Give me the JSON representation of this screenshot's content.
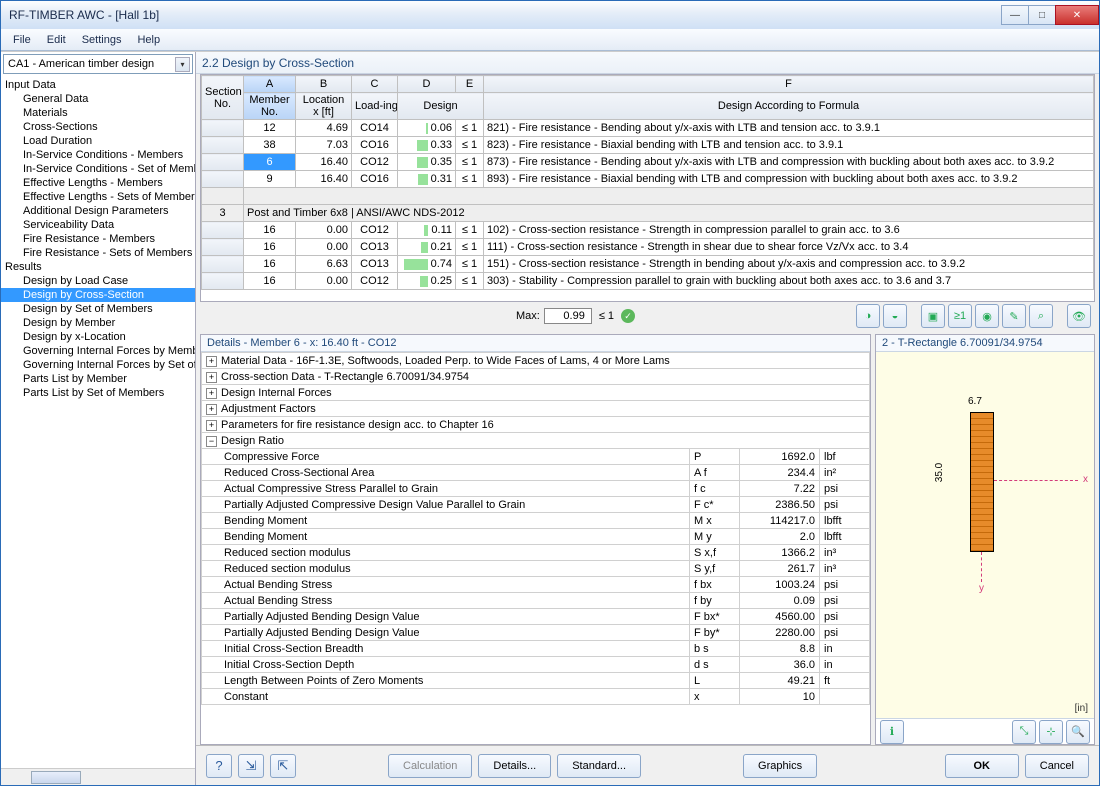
{
  "window": {
    "title": "RF-TIMBER AWC - [Hall 1b]"
  },
  "menu": [
    "File",
    "Edit",
    "Settings",
    "Help"
  ],
  "combo": "CA1 - American timber design",
  "tree": {
    "input_header": "Input Data",
    "input_items": [
      "General Data",
      "Materials",
      "Cross-Sections",
      "Load Duration",
      "In-Service Conditions - Members",
      "In-Service Conditions - Set of Members",
      "Effective Lengths - Members",
      "Effective Lengths - Sets of Members",
      "Additional Design Parameters",
      "Serviceability Data",
      "Fire Resistance - Members",
      "Fire Resistance - Sets of Members"
    ],
    "results_header": "Results",
    "results_items": [
      "Design by Load Case",
      "Design by Cross-Section",
      "Design by Set of Members",
      "Design by Member",
      "Design by x-Location",
      "Governing Internal Forces by Member",
      "Governing Internal Forces by Set of Members",
      "Parts List by Member",
      "Parts List by Set of Members"
    ],
    "selected": "Design by Cross-Section"
  },
  "section_title": "2.2  Design by Cross-Section",
  "grid": {
    "colLetters": [
      "A",
      "B",
      "C",
      "D",
      "E",
      "F"
    ],
    "h_section": "Section No.",
    "h_member": "Member No.",
    "h_location": "Location x [ft]",
    "h_loading": "Load-ing",
    "h_design": "Design",
    "h_formula": "Design According to Formula",
    "rows": [
      {
        "member": "12",
        "x": "4.69",
        "load": "CO14",
        "bar": 6,
        "design": "0.06",
        "le": "≤ 1",
        "desc": "821) - Fire resistance - Bending about y/x-axis with LTB and tension acc. to 3.9.1"
      },
      {
        "member": "38",
        "x": "7.03",
        "load": "CO16",
        "bar": 33,
        "design": "0.33",
        "le": "≤ 1",
        "desc": "823) - Fire resistance - Biaxial bending with LTB and tension acc. to 3.9.1"
      },
      {
        "member": "6",
        "x": "16.40",
        "load": "CO12",
        "bar": 35,
        "design": "0.35",
        "le": "≤ 1",
        "desc": "873) - Fire resistance - Bending about y/x-axis with LTB and compression with buckling about both axes acc. to 3.9.2",
        "sel": true
      },
      {
        "member": "9",
        "x": "16.40",
        "load": "CO16",
        "bar": 31,
        "design": "0.31",
        "le": "≤ 1",
        "desc": "893) - Fire resistance - Biaxial bending with LTB and compression with buckling about both axes acc. to 3.9.2"
      }
    ],
    "group": {
      "no": "3",
      "label": "Post and Timber 6x8 | ANSI/AWC NDS-2012"
    },
    "rows2": [
      {
        "member": "16",
        "x": "0.00",
        "load": "CO12",
        "bar": 11,
        "design": "0.11",
        "le": "≤ 1",
        "desc": "102) - Cross-section resistance - Strength in compression parallel to grain acc. to 3.6"
      },
      {
        "member": "16",
        "x": "0.00",
        "load": "CO13",
        "bar": 21,
        "design": "0.21",
        "le": "≤ 1",
        "desc": "111) - Cross-section resistance - Strength in shear due to shear force Vz/Vx acc. to 3.4"
      },
      {
        "member": "16",
        "x": "6.63",
        "load": "CO13",
        "bar": 74,
        "design": "0.74",
        "le": "≤ 1",
        "desc": "151) - Cross-section resistance - Strength in bending about y/x-axis and compression acc. to 3.9.2"
      },
      {
        "member": "16",
        "x": "0.00",
        "load": "CO12",
        "bar": 25,
        "design": "0.25",
        "le": "≤ 1",
        "desc": "303) - Stability - Compression parallel to grain with buckling about both axes acc. to 3.6 and 3.7"
      }
    ],
    "max_label": "Max:",
    "max_val": "0.99",
    "max_le": "≤ 1"
  },
  "details": {
    "header": "Details - Member 6 - x: 16.40 ft - CO12",
    "collapsed": [
      "Material Data - 16F-1.3E, Softwoods, Loaded Perp. to Wide Faces of Lams, 4 or More Lams",
      "Cross-section Data - T-Rectangle 6.70091/34.9754",
      "Design Internal Forces",
      "Adjustment Factors",
      "Parameters for fire resistance design acc. to Chapter 16"
    ],
    "ratio_label": "Design Ratio",
    "rows": [
      {
        "n": "Compressive Force",
        "s": "P",
        "v": "1692.0",
        "u": "lbf"
      },
      {
        "n": "Reduced Cross-Sectional Area",
        "s": "A f",
        "v": "234.4",
        "u": "in²"
      },
      {
        "n": "Actual Compressive Stress Parallel to Grain",
        "s": "f c",
        "v": "7.22",
        "u": "psi"
      },
      {
        "n": "Partially Adjusted Compressive Design Value Parallel to Grain",
        "s": "F c*",
        "v": "2386.50",
        "u": "psi"
      },
      {
        "n": "Bending Moment",
        "s": "M x",
        "v": "114217.0",
        "u": "lbfft"
      },
      {
        "n": "Bending Moment",
        "s": "M y",
        "v": "2.0",
        "u": "lbfft"
      },
      {
        "n": "Reduced section modulus",
        "s": "S x,f",
        "v": "1366.2",
        "u": "in³"
      },
      {
        "n": "Reduced section modulus",
        "s": "S y,f",
        "v": "261.7",
        "u": "in³"
      },
      {
        "n": "Actual Bending Stress",
        "s": "f bx",
        "v": "1003.24",
        "u": "psi"
      },
      {
        "n": "Actual Bending Stress",
        "s": "f by",
        "v": "0.09",
        "u": "psi"
      },
      {
        "n": "Partially Adjusted Bending Design Value",
        "s": "F bx*",
        "v": "4560.00",
        "u": "psi"
      },
      {
        "n": "Partially Adjusted Bending Design Value",
        "s": "F by*",
        "v": "2280.00",
        "u": "psi"
      },
      {
        "n": "Initial Cross-Section Breadth",
        "s": "b s",
        "v": "8.8",
        "u": "in"
      },
      {
        "n": "Initial Cross-Section Depth",
        "s": "d s",
        "v": "36.0",
        "u": "in"
      },
      {
        "n": "Length Between Points of Zero Moments",
        "s": "L",
        "v": "49.21",
        "u": "ft"
      },
      {
        "n": "Constant",
        "s": "x",
        "v": "10",
        "u": ""
      }
    ]
  },
  "cs": {
    "header": "2 - T-Rectangle 6.70091/34.9754",
    "w": "6.7",
    "h": "35.0",
    "unit": "[in]"
  },
  "footer": {
    "calc": "Calculation",
    "details": "Details...",
    "standard": "Standard...",
    "graphics": "Graphics",
    "ok": "OK",
    "cancel": "Cancel"
  }
}
